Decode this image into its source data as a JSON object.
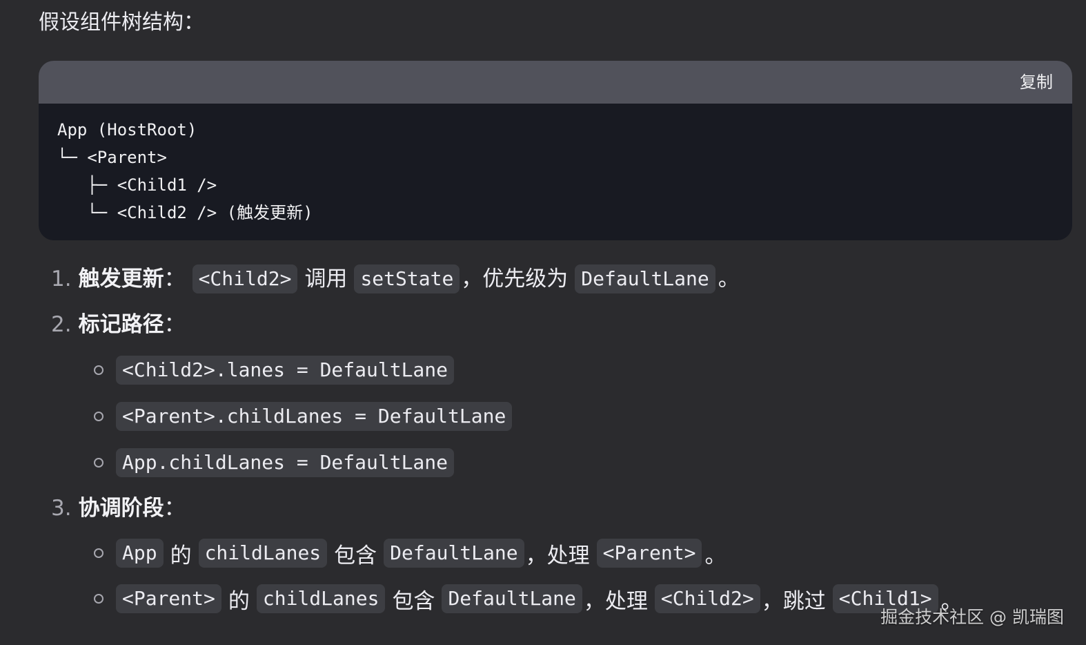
{
  "heading": "假设组件树结构：",
  "code_block": {
    "copy_label": "复制",
    "lines": [
      "App (HostRoot)",
      "└─ <Parent>",
      "   ├─ <Child1 />",
      "   └─ <Child2 /> (触发更新)"
    ]
  },
  "steps": [
    {
      "number": "1.",
      "title": "触发更新",
      "suffix": "：",
      "parts": [
        "<Child2>",
        "调用",
        "setState",
        "，优先级为",
        "DefaultLane",
        "。"
      ]
    },
    {
      "number": "2.",
      "title": "标记路径",
      "suffix": "：",
      "bullets": [
        "<Child2>.lanes = DefaultLane",
        "<Parent>.childLanes = DefaultLane",
        "App.childLanes = DefaultLane"
      ]
    },
    {
      "number": "3.",
      "title": "协调阶段",
      "suffix": "：",
      "bullets": [
        [
          "App",
          "的",
          "childLanes",
          "包含",
          "DefaultLane",
          "，处理",
          "<Parent>",
          "。"
        ],
        [
          "<Parent>",
          "的",
          "childLanes",
          "包含",
          "DefaultLane",
          "，处理",
          "<Child2>",
          "，跳过",
          "<Child1>",
          "。"
        ]
      ]
    }
  ],
  "watermark": "掘金技术社区 @ 凯瑞图"
}
